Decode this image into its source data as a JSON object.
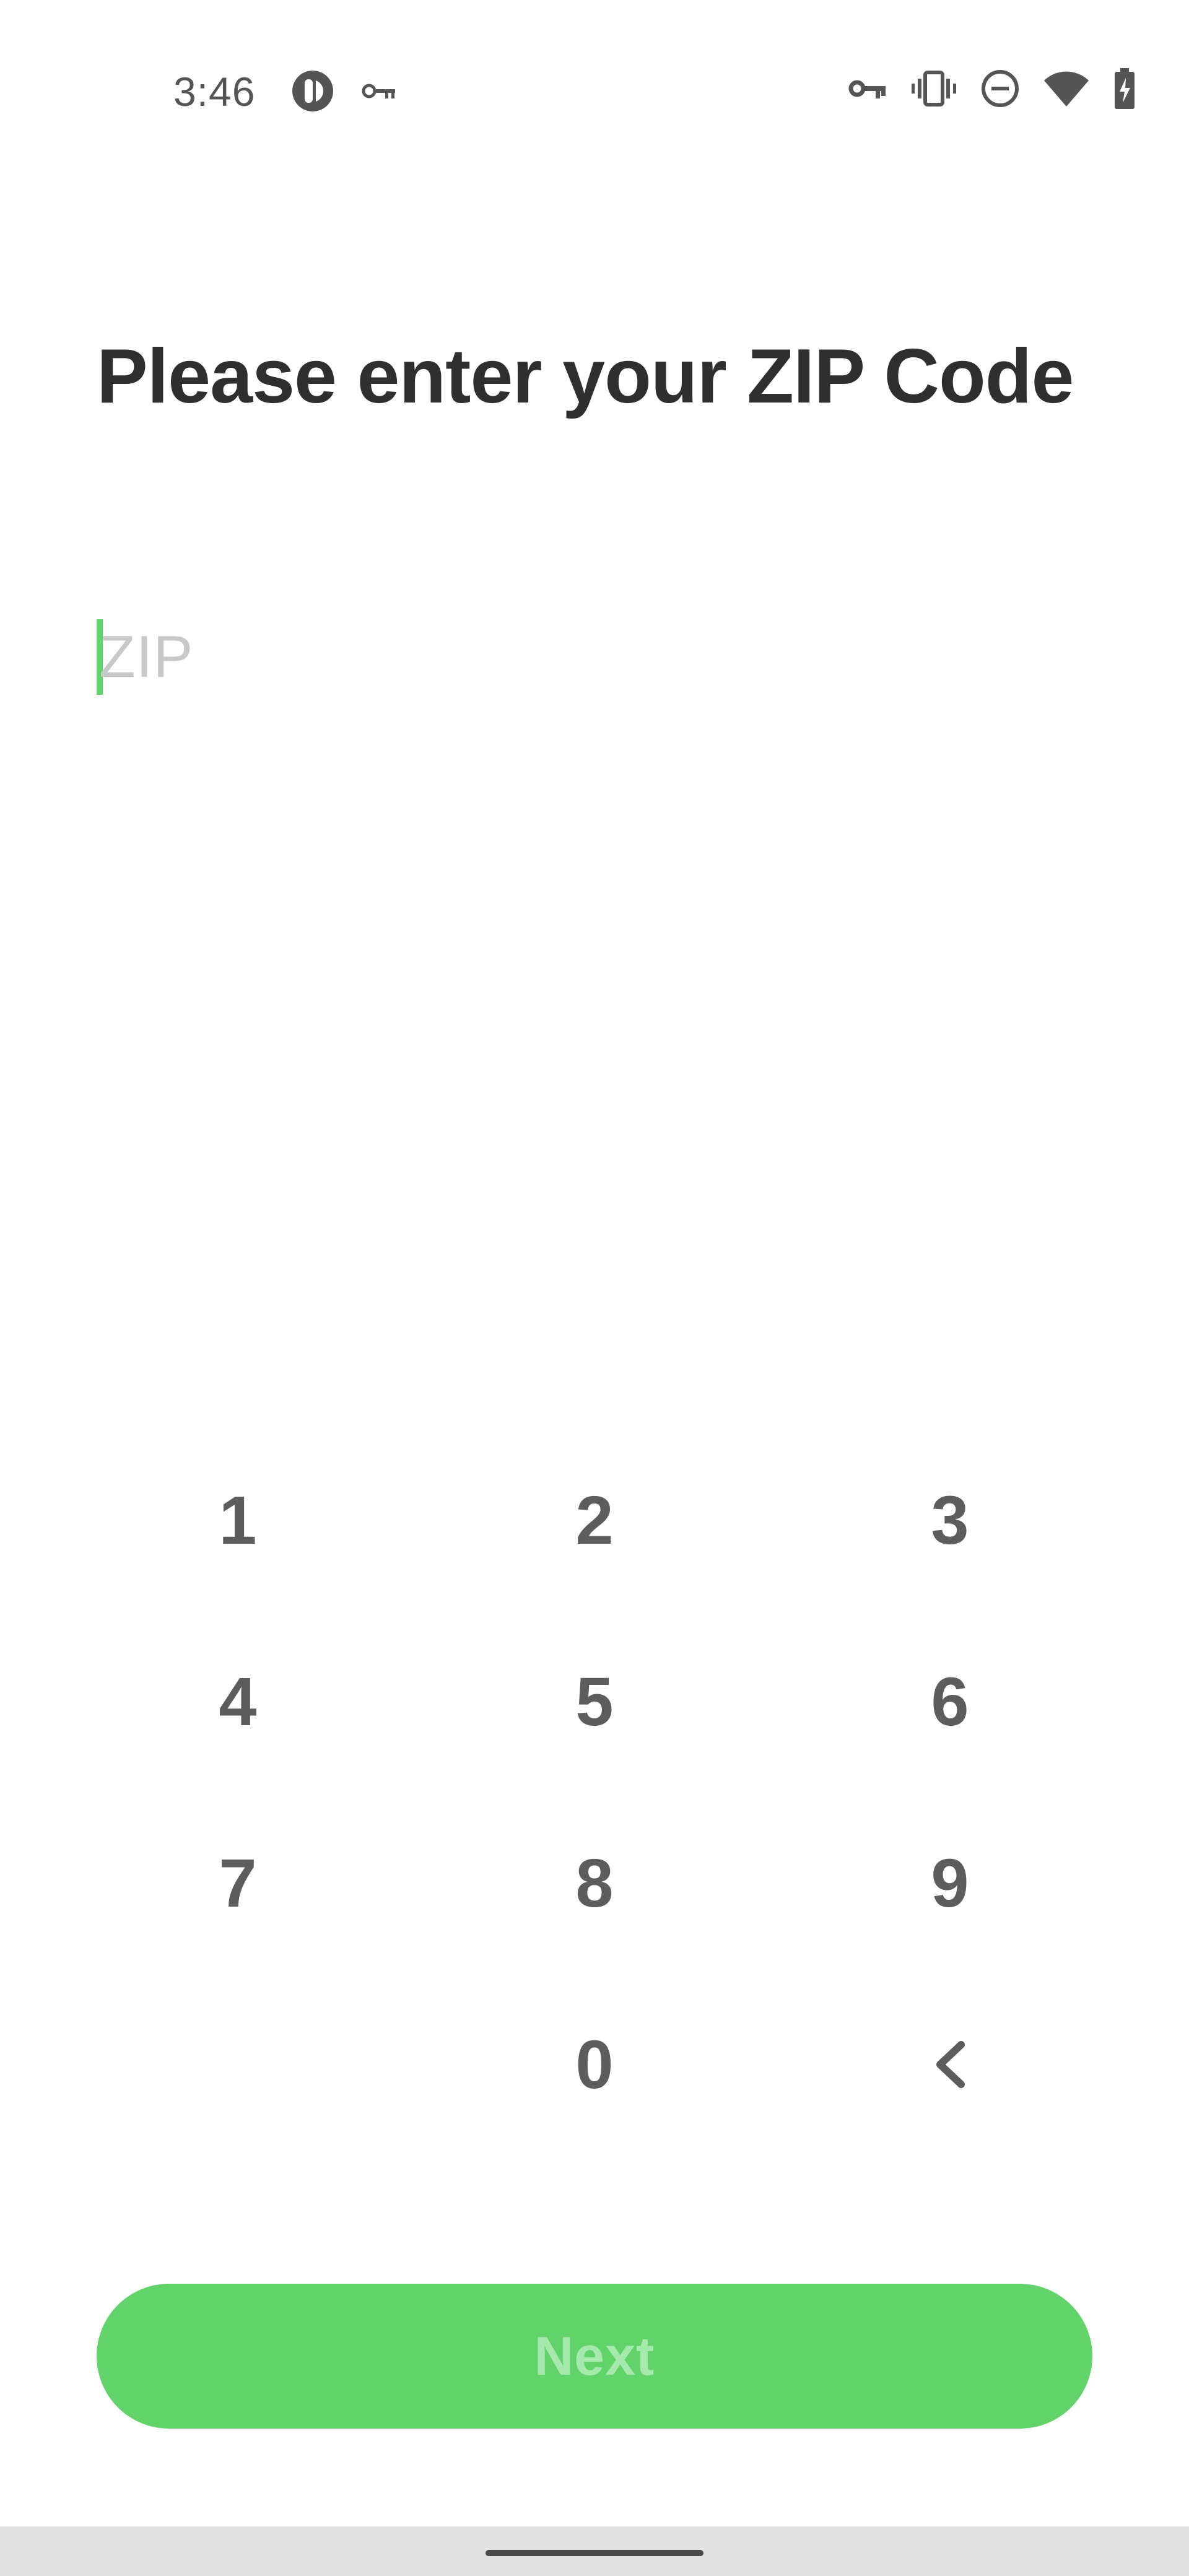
{
  "status_bar": {
    "time": "3:46",
    "left_icons": [
      "app-notification-icon",
      "key-icon"
    ],
    "right_icons": [
      "vpn-key-icon",
      "vibrate-icon",
      "do-not-disturb-icon",
      "wifi-icon",
      "battery-charging-icon"
    ]
  },
  "screen": {
    "title": "Please enter your ZIP Code",
    "zip_field": {
      "value": "",
      "placeholder": "ZIP"
    }
  },
  "keypad": {
    "keys": [
      "1",
      "2",
      "3",
      "4",
      "5",
      "6",
      "7",
      "8",
      "9",
      "0"
    ],
    "backspace_icon": "backspace-chevron-icon"
  },
  "actions": {
    "next_label": "Next"
  },
  "colors": {
    "accent": "#61d36a",
    "next_disabled_text": "#a6e9ad",
    "title_text": "#2f2f2f",
    "key_text": "#5d5d5d",
    "placeholder_text": "#c8c8c8"
  }
}
